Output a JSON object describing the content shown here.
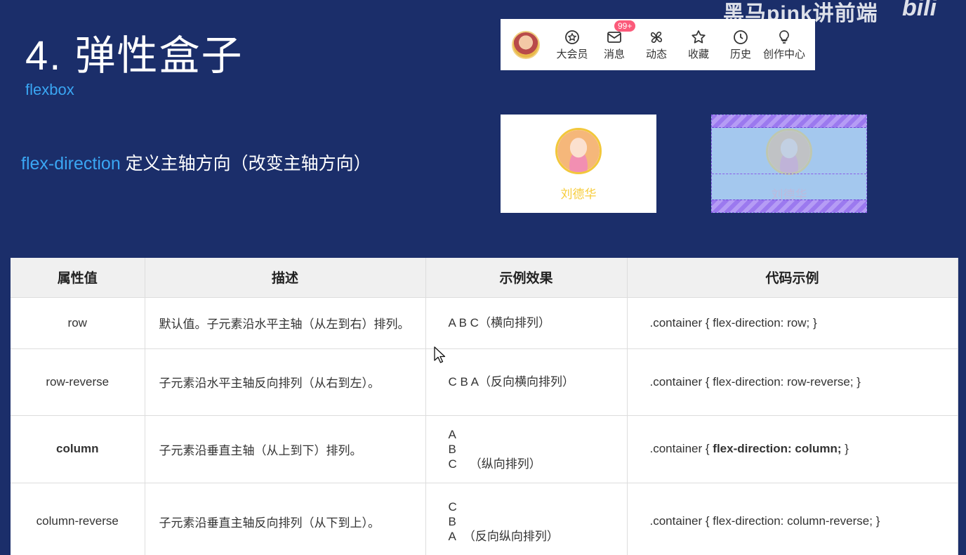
{
  "watermark": "黑马pink讲前端",
  "bili_logo": "bili",
  "title": "4. 弹性盒子",
  "subtitle": "flexbox",
  "definition": {
    "keyword": "flex-direction",
    "text": " 定义主轴方向（改变主轴方向）"
  },
  "navbar": {
    "items": [
      {
        "label": "大会员",
        "icon": "vip-icon"
      },
      {
        "label": "消息",
        "icon": "mail-icon",
        "badge": "99+"
      },
      {
        "label": "动态",
        "icon": "fan-icon"
      },
      {
        "label": "收藏",
        "icon": "star-icon"
      },
      {
        "label": "历史",
        "icon": "clock-icon"
      },
      {
        "label": "创作中心",
        "icon": "lightbulb-icon"
      }
    ]
  },
  "cards": {
    "left_name": "刘德华",
    "right_name": "刘德华"
  },
  "table": {
    "headers": [
      "属性值",
      "描述",
      "示例效果",
      "代码示例"
    ],
    "rows": [
      {
        "value": "row",
        "desc": "默认值。子元素沿水平主轴（从左到右）排列。",
        "example": [
          "A B C（横向排列）"
        ],
        "code_prefix": ".container { ",
        "code_main": "flex-direction: row;",
        "code_suffix": " }"
      },
      {
        "value": "row-reverse",
        "desc": "子元素沿水平主轴反向排列（从右到左）。",
        "example": [
          "C B A（反向横向排列）"
        ],
        "code_prefix": ".container { ",
        "code_main": "flex-direction: row-reverse;",
        "code_suffix": " }"
      },
      {
        "value": "column",
        "desc": "子元素沿垂直主轴（从上到下）排列。",
        "example": [
          "A",
          "B",
          "C",
          "（纵向排列）"
        ],
        "code_prefix": ".container { ",
        "code_main": "flex-direction: column;",
        "code_suffix": " }"
      },
      {
        "value": "column-reverse",
        "desc": "子元素沿垂直主轴反向排列（从下到上）。",
        "example": [
          "C",
          "B",
          "A",
          "（反向纵向排列）"
        ],
        "code_prefix": ".container { ",
        "code_main": "flex-direction: column-reverse;",
        "code_suffix": " }"
      }
    ]
  }
}
